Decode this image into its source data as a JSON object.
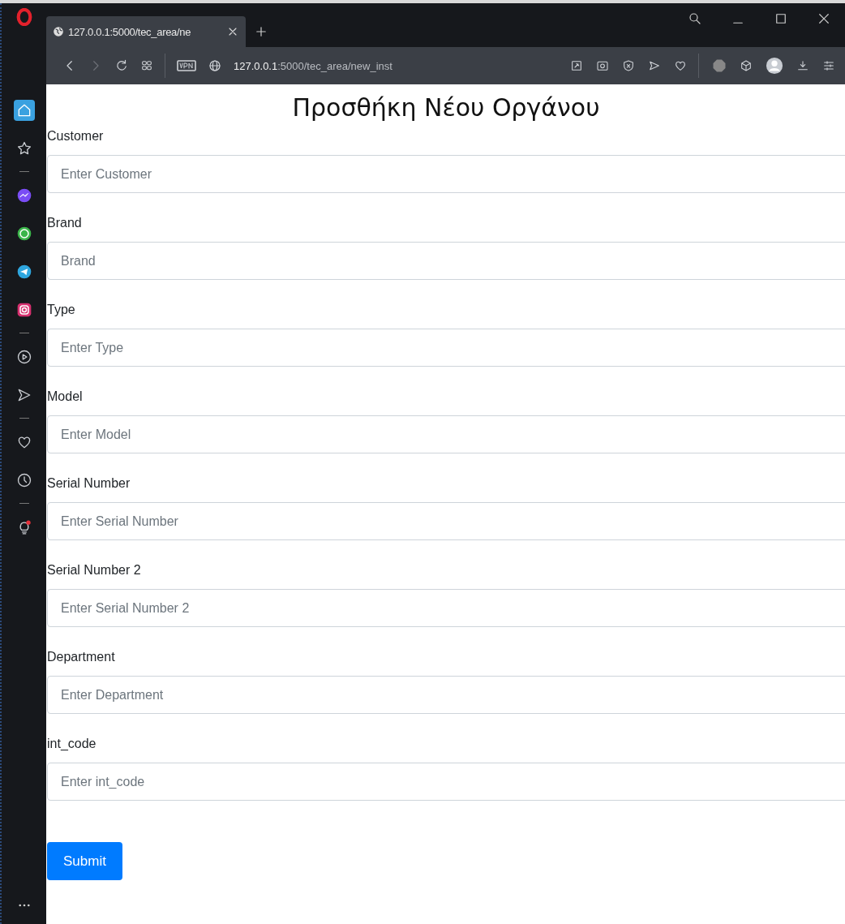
{
  "browser": {
    "tab": {
      "title": "127.0.0.1:5000/tec_area/ne",
      "selected": true
    },
    "address": {
      "host": "127.0.0.1",
      "path": ":5000/tec_area/new_inst"
    }
  },
  "sidebar": {
    "items": [
      {
        "selected": true
      },
      {
        "selected": false
      },
      {
        "selected": false
      },
      {
        "selected": false
      },
      {
        "selected": false
      },
      {
        "selected": false
      },
      {
        "selected": false
      },
      {
        "selected": false
      },
      {
        "selected": false
      },
      {
        "selected": false
      },
      {
        "selected": false
      }
    ]
  },
  "page": {
    "title": "Προσθήκη Νέου Οργάνου",
    "fields": [
      {
        "label": "Customer",
        "placeholder": "Enter Customer"
      },
      {
        "label": "Brand",
        "placeholder": "Brand"
      },
      {
        "label": "Type",
        "placeholder": "Enter Type"
      },
      {
        "label": "Model",
        "placeholder": "Enter Model"
      },
      {
        "label": "Serial Number",
        "placeholder": "Enter Serial Number"
      },
      {
        "label": "Serial Number 2",
        "placeholder": "Enter Serial Number 2"
      },
      {
        "label": "Department",
        "placeholder": "Enter Department"
      },
      {
        "label": "int_code",
        "placeholder": "Enter int_code"
      }
    ],
    "submit": "Submit"
  }
}
